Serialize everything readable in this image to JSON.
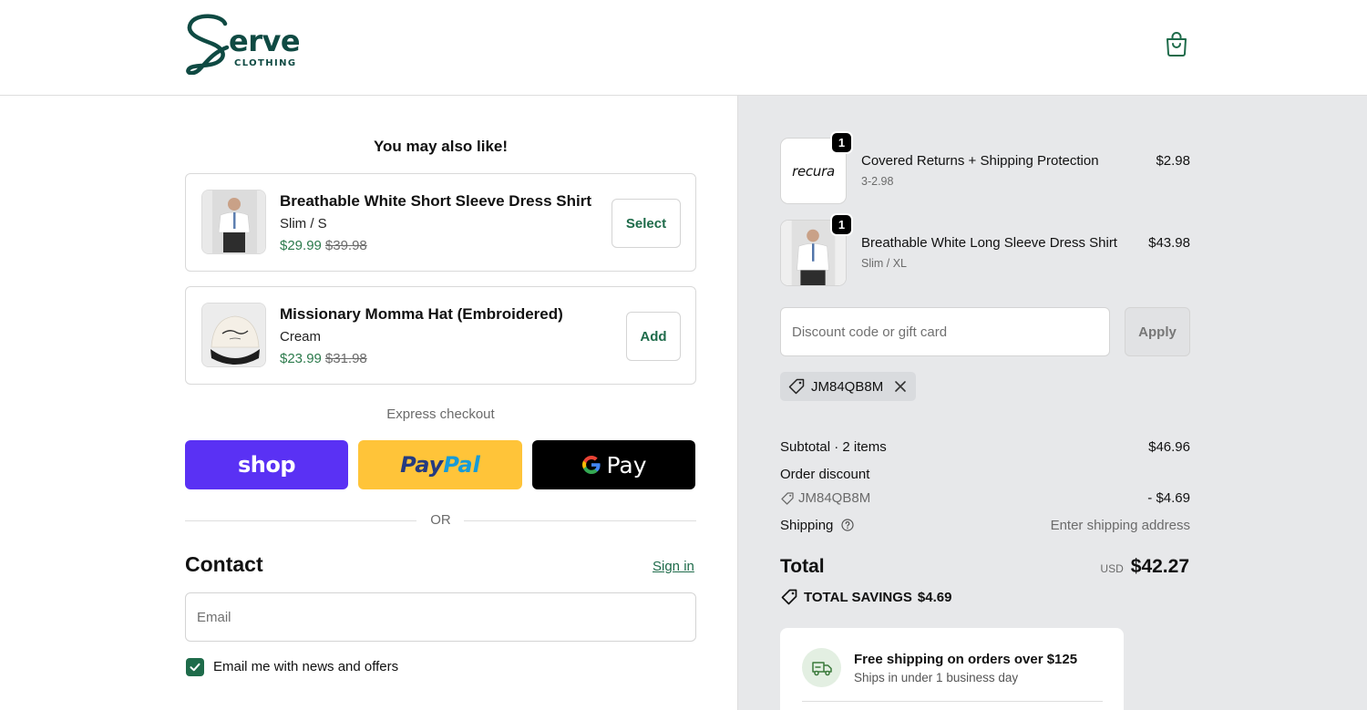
{
  "brand": {
    "logo_word": "erve",
    "logo_sub": "CLOTHING",
    "color": "#0f4a43"
  },
  "header": {
    "cart_icon": "shopping-bag-icon"
  },
  "upsell": {
    "title": "You may also like!",
    "items": [
      {
        "name": "Breathable White Short Sleeve Dress Shirt",
        "variant": "Slim / S",
        "price": "$29.99",
        "compare_price": "$39.98",
        "button": "Select"
      },
      {
        "name": "Missionary Momma Hat (Embroidered)",
        "variant": "Cream",
        "price": "$23.99",
        "compare_price": "$31.98",
        "button": "Add"
      }
    ]
  },
  "express": {
    "label": "Express checkout",
    "shop_label": "shop",
    "paypal_pay": "Pay",
    "paypal_pal": "Pal",
    "gpay_label": "Pay"
  },
  "divider_text": "OR",
  "contact": {
    "title": "Contact",
    "sign_in": "Sign in",
    "email_placeholder": "Email",
    "newsletter_label": "Email me with news and offers",
    "newsletter_checked": true
  },
  "cart": {
    "items": [
      {
        "thumb_text": "recura",
        "qty": "1",
        "name": "Covered Returns + Shipping Protection",
        "sub": "3-2.98",
        "price": "$2.98"
      },
      {
        "qty": "1",
        "name": "Breathable White Long Sleeve Dress Shirt",
        "sub": "Slim / XL",
        "price": "$43.98"
      }
    ],
    "discount_placeholder": "Discount code or gift card",
    "apply_label": "Apply",
    "applied_code": "JM84QB8M"
  },
  "summary": {
    "subtotal_label": "Subtotal · 2 items",
    "subtotal_value": "$46.96",
    "order_discount_label": "Order discount",
    "discount_code": "JM84QB8M",
    "discount_value": "- $4.69",
    "shipping_label": "Shipping",
    "shipping_value": "Enter shipping address",
    "total_label": "Total",
    "currency": "USD",
    "total_value": "$42.27",
    "savings_label": "TOTAL SAVINGS",
    "savings_value": "$4.69"
  },
  "promo": {
    "title": "Free shipping on orders over $125",
    "subtitle": "Ships in under 1 business day"
  },
  "colors": {
    "accent": "#1e6b4a",
    "sale_price": "#2b7a4b",
    "shop_pay": "#5a31f4",
    "paypal": "#ffc439",
    "right_panel_bg": "#e7e8ea"
  }
}
